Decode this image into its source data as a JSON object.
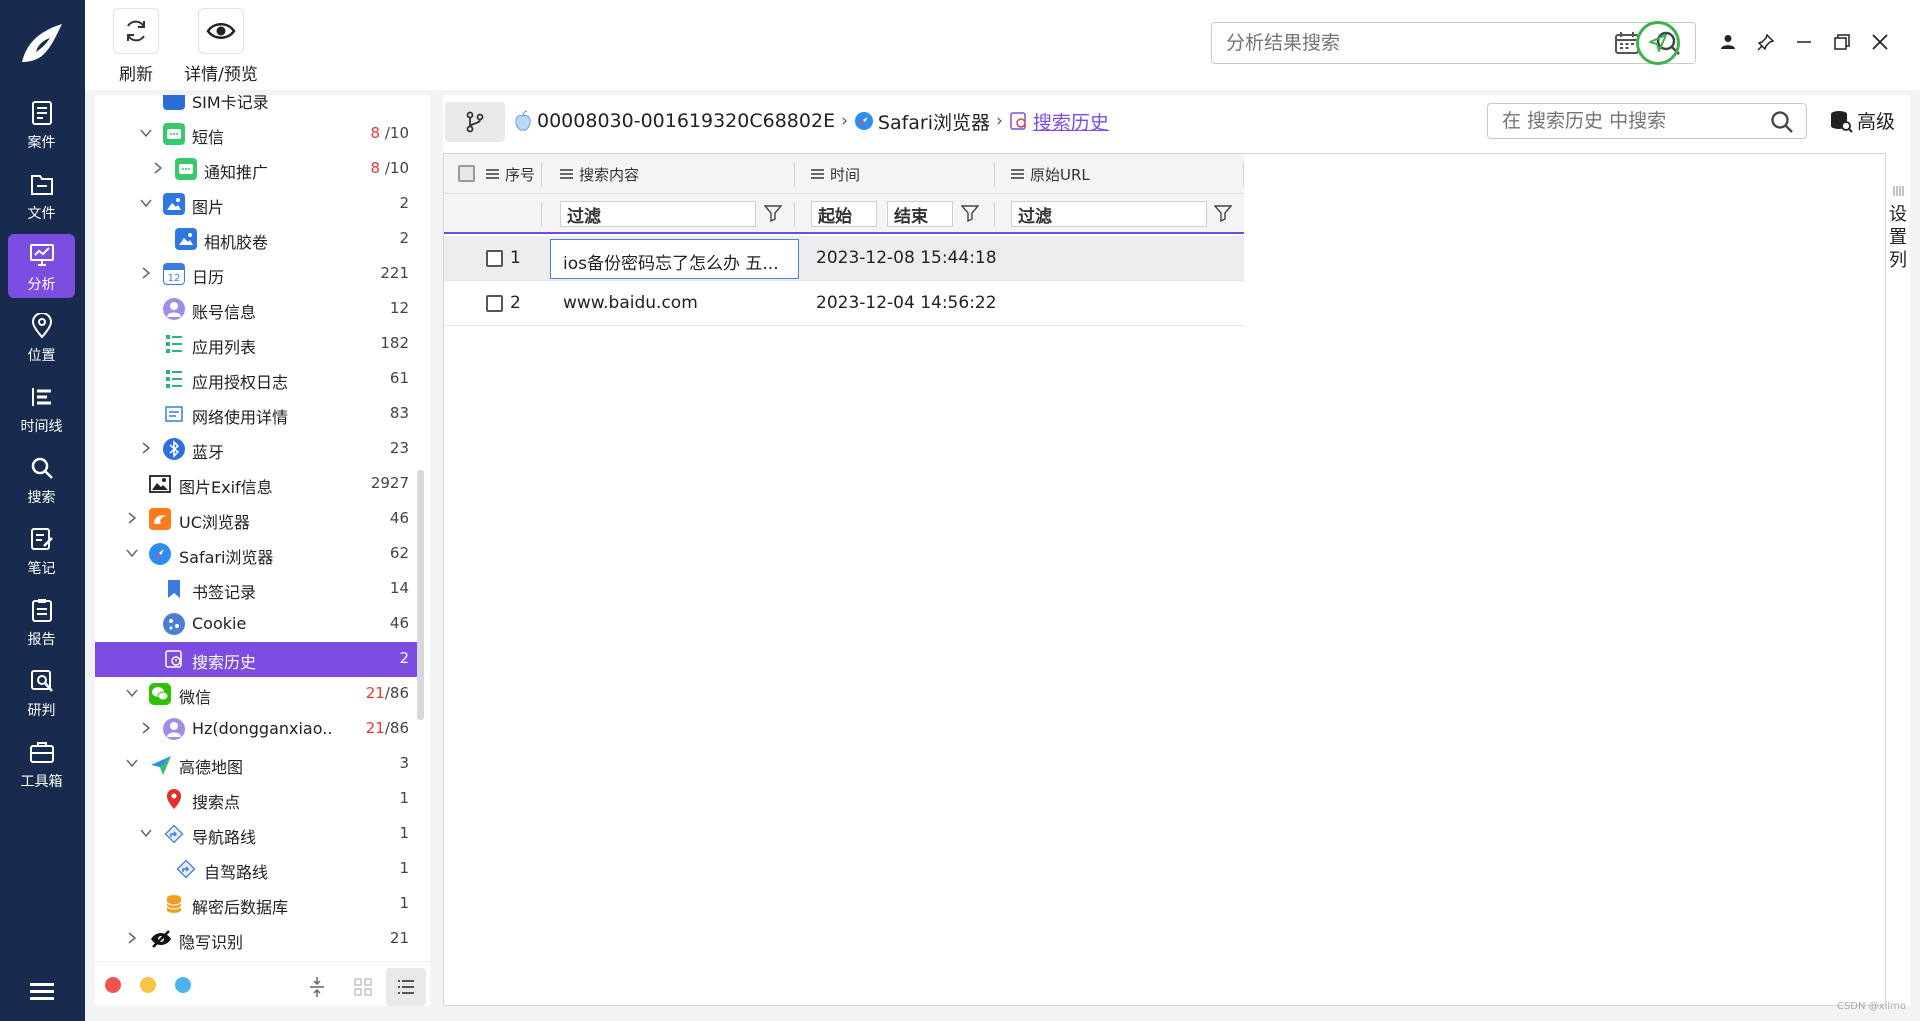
{
  "nav": {
    "items": [
      {
        "label": "案件",
        "icon": "case-icon"
      },
      {
        "label": "文件",
        "icon": "folder-icon"
      },
      {
        "label": "分析",
        "icon": "analysis-icon",
        "active": true
      },
      {
        "label": "位置",
        "icon": "location-icon"
      },
      {
        "label": "时间线",
        "icon": "timeline-icon"
      },
      {
        "label": "搜索",
        "icon": "search-icon"
      },
      {
        "label": "笔记",
        "icon": "note-icon"
      },
      {
        "label": "报告",
        "icon": "report-icon"
      },
      {
        "label": "研判",
        "icon": "judge-icon"
      },
      {
        "label": "工具箱",
        "icon": "toolbox-icon"
      }
    ]
  },
  "toolbar": {
    "refresh_label": "刷新",
    "preview_label": "详情/预览",
    "search_placeholder": "分析结果搜索"
  },
  "tree": {
    "rows": [
      {
        "label": "SIM卡记录",
        "count": "",
        "icon": "sim-icon"
      },
      {
        "label": "短信",
        "count_red": "8",
        "count": "/10",
        "icon": "sms-icon"
      },
      {
        "label": "通知推广",
        "count_red": "8",
        "count": "/10",
        "icon": "sms-icon"
      },
      {
        "label": "图片",
        "count": "2",
        "icon": "image-icon"
      },
      {
        "label": "相机胶卷",
        "count": "2",
        "icon": "image-icon"
      },
      {
        "label": "日历",
        "count": "221",
        "icon": "calendar-icon"
      },
      {
        "label": "账号信息",
        "count": "12",
        "icon": "account-icon"
      },
      {
        "label": "应用列表",
        "count": "182",
        "icon": "app-list-icon"
      },
      {
        "label": "应用授权日志",
        "count": "61",
        "icon": "app-list-icon"
      },
      {
        "label": "网络使用详情",
        "count": "83",
        "icon": "network-icon"
      },
      {
        "label": "蓝牙",
        "count": "23",
        "icon": "bluetooth-icon"
      },
      {
        "label": "图片Exif信息",
        "count": "2927",
        "icon": "exif-icon"
      },
      {
        "label": "UC浏览器",
        "count": "46",
        "icon": "uc-browser-icon"
      },
      {
        "label": "Safari浏览器",
        "count": "62",
        "icon": "safari-icon"
      },
      {
        "label": "书签记录",
        "count": "14",
        "icon": "bookmark-icon"
      },
      {
        "label": "Cookie",
        "count": "46",
        "icon": "cookie-icon"
      },
      {
        "label": "搜索历史",
        "count": "2",
        "icon": "search-history-icon"
      },
      {
        "label": "微信",
        "count_red": "21",
        "count": "/86",
        "icon": "wechat-icon"
      },
      {
        "label": "Hz(dongganxiao...",
        "count_red": "21",
        "count": "/86",
        "icon": "account-icon"
      },
      {
        "label": "高德地图",
        "count": "3",
        "icon": "amap-icon"
      },
      {
        "label": "搜索点",
        "count": "1",
        "icon": "pin-icon"
      },
      {
        "label": "导航路线",
        "count": "1",
        "icon": "route-icon"
      },
      {
        "label": "自驾路线",
        "count": "1",
        "icon": "route-icon"
      },
      {
        "label": "解密后数据库",
        "count": "1",
        "icon": "database-icon"
      },
      {
        "label": "隐写识别",
        "count": "21",
        "icon": "stego-icon"
      }
    ]
  },
  "main": {
    "breadcrumb": {
      "device": "00008030-001619320C68802E",
      "app": "Safari浏览器",
      "current": "搜索历史"
    },
    "search_placeholder": "在 搜索历史 中搜索",
    "advanced_label": "高级",
    "columns": {
      "index": "序号",
      "content": "搜索内容",
      "time": "时间",
      "url": "原始URL"
    },
    "filters": {
      "content": "过滤",
      "time_start": "起始",
      "time_end": "结束",
      "url": "过滤"
    },
    "rows": [
      {
        "index": "1",
        "content": "ios备份密码忘了怎么办 五...",
        "time": "2023-12-08 15:44:18",
        "url": ""
      },
      {
        "index": "2",
        "content": "www.baidu.com",
        "time": "2023-12-04 14:56:22",
        "url": ""
      }
    ],
    "settings_column_label": "设置列"
  },
  "watermark": "CSDN @xilmo",
  "colors": {
    "nav_bg": "#182a4e",
    "accent": "#7b4de0",
    "count_red": "#e23b3b",
    "send_green": "#3bb24a"
  }
}
